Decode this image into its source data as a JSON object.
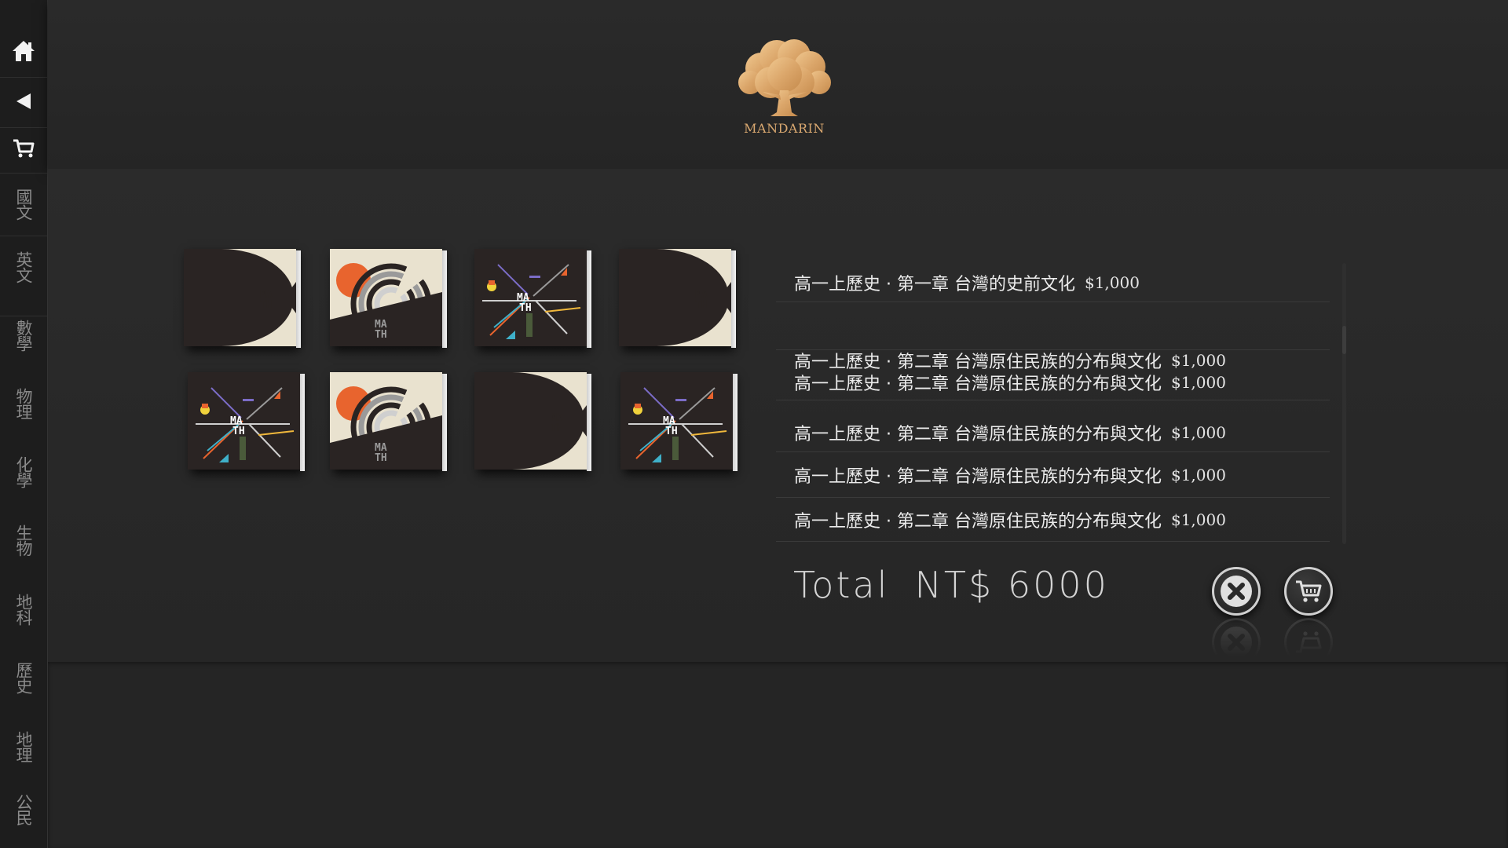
{
  "app": {
    "logo_text": "MANDARIN"
  },
  "sidebar": {
    "icons": [
      {
        "name": "home-icon"
      },
      {
        "name": "back-icon"
      },
      {
        "name": "cart-icon"
      }
    ],
    "items": [
      {
        "label": "國文"
      },
      {
        "label": "英文"
      },
      {
        "label": "數學"
      },
      {
        "label": "物理"
      },
      {
        "label": "化學"
      },
      {
        "label": "生物"
      },
      {
        "label": "地科"
      },
      {
        "label": "歷史"
      },
      {
        "label": "地理"
      },
      {
        "label": "公民"
      }
    ]
  },
  "books": [
    {
      "cover": "math-arc"
    },
    {
      "cover": "math-sun"
    },
    {
      "cover": "math-burst"
    },
    {
      "cover": "math-arc"
    },
    {
      "cover": "math-burst"
    },
    {
      "cover": "math-sun"
    },
    {
      "cover": "math-arc"
    },
    {
      "cover": "math-burst"
    }
  ],
  "cart": {
    "items": [
      {
        "title": "高一上歷史 · 第一章 台灣的史前文化",
        "price": "$1,000"
      },
      {
        "title": "高一上歷史 · 第二章 台灣原住民族的分布與文化",
        "price": "$1,000"
      },
      {
        "title": "高一上歷史 · 第二章 台灣原住民族的分布與文化",
        "price": "$1,000"
      },
      {
        "title": "高一上歷史 · 第二章 台灣原住民族的分布與文化",
        "price": "$1,000"
      },
      {
        "title": "高一上歷史 · 第二章 台灣原住民族的分布與文化",
        "price": "$1,000"
      },
      {
        "title": "高一上歷史 · 第二章 台灣原住民族的分布與文化",
        "price": "$1,000"
      }
    ],
    "total_label": "Total",
    "total_amount": "NT$ 6000"
  },
  "actions": {
    "clear": {
      "icon": "close-circle-icon"
    },
    "checkout": {
      "icon": "cart-icon"
    }
  },
  "colors": {
    "background": "#262626",
    "sidebar": "#1d1d1d",
    "logo_wood": "#d9a870",
    "text": "#ececec"
  }
}
